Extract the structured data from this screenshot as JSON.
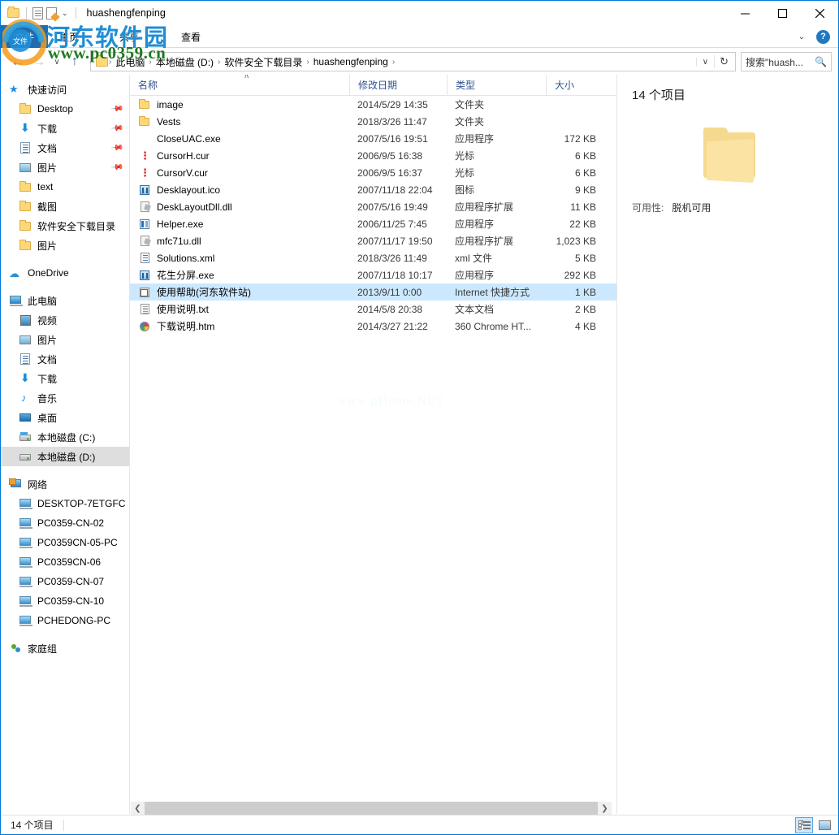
{
  "window": {
    "title": "huashengfenping",
    "quick_access_toolbar": [
      {
        "name": "folder-icon",
        "label": "文件夹"
      },
      {
        "name": "properties-icon",
        "label": "属性"
      },
      {
        "name": "new-folder-icon",
        "label": "新建文件夹"
      },
      {
        "name": "chevron-down-icon",
        "label": "自定义快速访问工具栏"
      }
    ],
    "controls": {
      "minimize": "最小化",
      "maximize": "最大化",
      "close": "关闭"
    }
  },
  "ribbon": {
    "file_tab": "文件",
    "tabs": [
      {
        "label": "主页"
      },
      {
        "label": "共享"
      },
      {
        "label": "查看"
      }
    ],
    "expand_label": "展开功能区",
    "help_label": "?"
  },
  "navbar": {
    "back": "←",
    "forward": "→",
    "recent": "∨",
    "up": "↑",
    "breadcrumbs": [
      "此电脑",
      "本地磁盘 (D:)",
      "软件安全下载目录",
      "huashengfenping"
    ],
    "separator": "›",
    "dropdown": "∨",
    "refresh": "↻"
  },
  "search": {
    "placeholder": "搜索\"huash...",
    "icon": "search-icon"
  },
  "sidebar": {
    "groups": [
      {
        "name": "快速访问",
        "icon": "star-icon",
        "items": [
          {
            "label": "Desktop",
            "icon": "folder-icon",
            "pinned": true
          },
          {
            "label": "下载",
            "icon": "download-icon",
            "pinned": true
          },
          {
            "label": "文档",
            "icon": "document-icon",
            "pinned": true
          },
          {
            "label": "图片",
            "icon": "picture-icon",
            "pinned": true
          },
          {
            "label": "text",
            "icon": "folder-icon",
            "pinned": false
          },
          {
            "label": "截图",
            "icon": "folder-icon",
            "pinned": false
          },
          {
            "label": "软件安全下载目录",
            "icon": "folder-icon",
            "pinned": false
          },
          {
            "label": "图片",
            "icon": "folder-icon",
            "pinned": false
          }
        ]
      },
      {
        "name": "OneDrive",
        "icon": "cloud-icon",
        "items": []
      },
      {
        "name": "此电脑",
        "icon": "computer-icon",
        "items": [
          {
            "label": "视频",
            "icon": "video-icon",
            "pinned": false
          },
          {
            "label": "图片",
            "icon": "picture-icon",
            "pinned": false
          },
          {
            "label": "文档",
            "icon": "document-icon",
            "pinned": false
          },
          {
            "label": "下载",
            "icon": "download-icon",
            "pinned": false
          },
          {
            "label": "音乐",
            "icon": "music-icon",
            "pinned": false
          },
          {
            "label": "桌面",
            "icon": "desktop-icon",
            "pinned": false
          },
          {
            "label": "本地磁盘 (C:)",
            "icon": "system-drive-icon",
            "pinned": false
          },
          {
            "label": "本地磁盘 (D:)",
            "icon": "drive-icon",
            "pinned": false,
            "selected": true
          }
        ]
      },
      {
        "name": "网络",
        "icon": "network-icon",
        "items": [
          {
            "label": "DESKTOP-7ETGFC",
            "icon": "monitor-icon"
          },
          {
            "label": "PC0359-CN-02",
            "icon": "monitor-icon"
          },
          {
            "label": "PC0359CN-05-PC",
            "icon": "monitor-icon"
          },
          {
            "label": "PC0359CN-06",
            "icon": "monitor-icon"
          },
          {
            "label": "PC0359-CN-07",
            "icon": "monitor-icon"
          },
          {
            "label": "PC0359-CN-10",
            "icon": "monitor-icon"
          },
          {
            "label": "PCHEDONG-PC",
            "icon": "monitor-icon"
          }
        ]
      },
      {
        "name": "家庭组",
        "icon": "homegroup-icon",
        "items": []
      }
    ]
  },
  "filelist": {
    "columns": [
      {
        "label": "名称",
        "key": "name"
      },
      {
        "label": "修改日期",
        "key": "date"
      },
      {
        "label": "类型",
        "key": "type"
      },
      {
        "label": "大小",
        "key": "size"
      }
    ],
    "sort_indicator": "∧",
    "rows": [
      {
        "name": "image",
        "date": "2014/5/29 14:35",
        "type": "文件夹",
        "size": "",
        "icon": "folder-icon",
        "selected": false
      },
      {
        "name": "Vests",
        "date": "2018/3/26 11:47",
        "type": "文件夹",
        "size": "",
        "icon": "folder-icon",
        "selected": false
      },
      {
        "name": "CloseUAC.exe",
        "date": "2007/5/16 19:51",
        "type": "应用程序",
        "size": "172 KB",
        "icon": "exe-blank-icon",
        "selected": false
      },
      {
        "name": "CursorH.cur",
        "date": "2006/9/5 16:38",
        "type": "光标",
        "size": "6 KB",
        "icon": "cursor-h-icon",
        "selected": false
      },
      {
        "name": "CursorV.cur",
        "date": "2006/9/5 16:37",
        "type": "光标",
        "size": "6 KB",
        "icon": "cursor-v-icon",
        "selected": false
      },
      {
        "name": "Desklayout.ico",
        "date": "2007/11/18 22:04",
        "type": "图标",
        "size": "9 KB",
        "icon": "ico-icon",
        "selected": false
      },
      {
        "name": "DeskLayoutDll.dll",
        "date": "2007/5/16 19:49",
        "type": "应用程序扩展",
        "size": "11 KB",
        "icon": "dll-icon",
        "selected": false
      },
      {
        "name": "Helper.exe",
        "date": "2006/11/25 7:45",
        "type": "应用程序",
        "size": "22 KB",
        "icon": "exe-icon",
        "selected": false
      },
      {
        "name": "mfc71u.dll",
        "date": "2007/11/17 19:50",
        "type": "应用程序扩展",
        "size": "1,023 KB",
        "icon": "dll-icon",
        "selected": false
      },
      {
        "name": "Solutions.xml",
        "date": "2018/3/26 11:49",
        "type": "xml 文件",
        "size": "5 KB",
        "icon": "xml-icon",
        "selected": false
      },
      {
        "name": "花生分屏.exe",
        "date": "2007/11/18 10:17",
        "type": "应用程序",
        "size": "292 KB",
        "icon": "ico-icon",
        "selected": false
      },
      {
        "name": "使用帮助(河东软件站)",
        "date": "2013/9/11 0:00",
        "type": "Internet 快捷方式",
        "size": "1 KB",
        "icon": "shortcut-icon",
        "selected": true
      },
      {
        "name": "使用说明.txt",
        "date": "2014/5/8 20:38",
        "type": "文本文档",
        "size": "2 KB",
        "icon": "text-icon",
        "selected": false
      },
      {
        "name": "下载说明.htm",
        "date": "2014/3/27 21:22",
        "type": "360 Chrome HT...",
        "size": "4 KB",
        "icon": "html-icon",
        "selected": false
      }
    ],
    "center_watermark": "www.pHome.NET"
  },
  "details_pane": {
    "title": "14 个项目",
    "icon": "large-folder-icon",
    "availability_label": "可用性:",
    "availability_value": "脱机可用"
  },
  "scrollbar": {
    "left_arrow": "❮",
    "right_arrow": "❯"
  },
  "statusbar": {
    "count": "14 个项目",
    "view_buttons": [
      {
        "name": "details-view-button",
        "label": "详细信息",
        "active": true
      },
      {
        "name": "large-icons-view-button",
        "label": "大图标",
        "active": false
      }
    ]
  },
  "watermark": {
    "site_name": "河东软件园",
    "site_url": "www.pc0359.cn"
  },
  "colors": {
    "window_border": "#0078d7",
    "file_tab": "#1f6cb0",
    "selection": "#cce8ff",
    "nav_selection": "#dedede",
    "column_header_text": "#31538f",
    "folder_yellow": "#fcd878"
  }
}
